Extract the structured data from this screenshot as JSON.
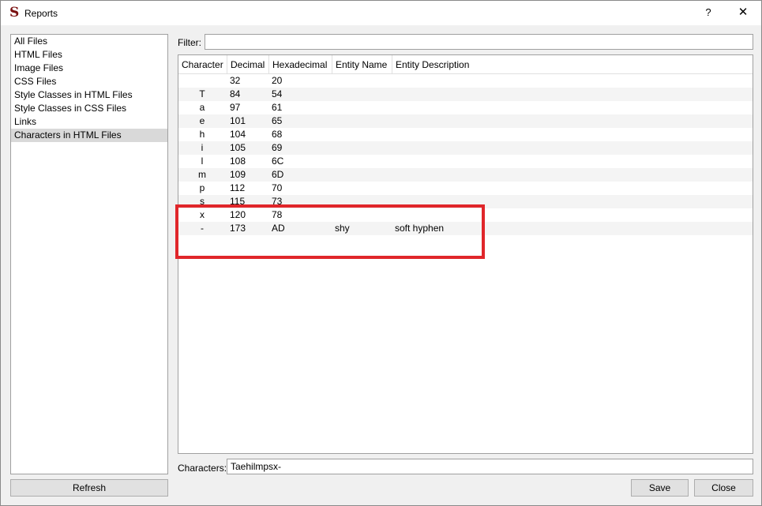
{
  "window": {
    "title": "Reports",
    "help_glyph": "?",
    "close_glyph": "✕",
    "app_glyph": "S"
  },
  "sidebar": {
    "items": [
      {
        "label": "All Files",
        "selected": false
      },
      {
        "label": "HTML Files",
        "selected": false
      },
      {
        "label": "Image Files",
        "selected": false
      },
      {
        "label": "CSS Files",
        "selected": false
      },
      {
        "label": "Style Classes in HTML Files",
        "selected": false
      },
      {
        "label": "Style Classes in CSS Files",
        "selected": false
      },
      {
        "label": "Links",
        "selected": false
      },
      {
        "label": "Characters in HTML Files",
        "selected": true
      }
    ]
  },
  "filter": {
    "label": "Filter:",
    "value": ""
  },
  "table": {
    "sort_indicator": "^",
    "columns": [
      "Character",
      "Decimal",
      "Hexadecimal",
      "Entity Name",
      "Entity Description"
    ],
    "rows": [
      {
        "char": "",
        "dec": "32",
        "hex": "20",
        "ename": "",
        "edesc": ""
      },
      {
        "char": "T",
        "dec": "84",
        "hex": "54",
        "ename": "",
        "edesc": ""
      },
      {
        "char": "a",
        "dec": "97",
        "hex": "61",
        "ename": "",
        "edesc": ""
      },
      {
        "char": "e",
        "dec": "101",
        "hex": "65",
        "ename": "",
        "edesc": ""
      },
      {
        "char": "h",
        "dec": "104",
        "hex": "68",
        "ename": "",
        "edesc": ""
      },
      {
        "char": "i",
        "dec": "105",
        "hex": "69",
        "ename": "",
        "edesc": ""
      },
      {
        "char": "l",
        "dec": "108",
        "hex": "6C",
        "ename": "",
        "edesc": ""
      },
      {
        "char": "m",
        "dec": "109",
        "hex": "6D",
        "ename": "",
        "edesc": ""
      },
      {
        "char": "p",
        "dec": "112",
        "hex": "70",
        "ename": "",
        "edesc": ""
      },
      {
        "char": "s",
        "dec": "115",
        "hex": "73",
        "ename": "",
        "edesc": ""
      },
      {
        "char": "x",
        "dec": "120",
        "hex": "78",
        "ename": "",
        "edesc": ""
      },
      {
        "char": "-",
        "dec": "173",
        "hex": "AD",
        "ename": "shy",
        "edesc": "soft hyphen"
      }
    ]
  },
  "characters": {
    "label": "Characters:",
    "value": "Taehilmpsx-"
  },
  "buttons": {
    "refresh": "Refresh",
    "save": "Save",
    "close": "Close"
  },
  "colors": {
    "highlight": "#e0262a",
    "selected_row": "#d9d9d9"
  }
}
